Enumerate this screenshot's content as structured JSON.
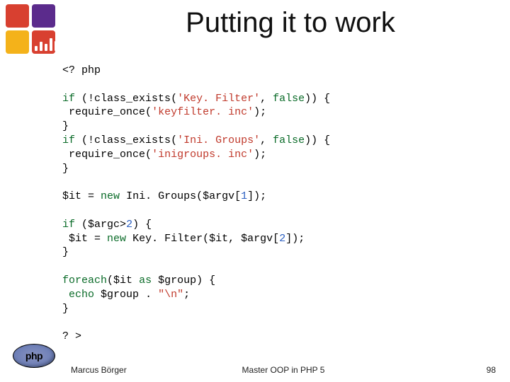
{
  "title": "Putting it to work",
  "code": {
    "open_tag": "<? php",
    "kw_if": "if",
    "kw_false": "false",
    "kw_new": "new",
    "kw_foreach": "foreach",
    "kw_as": "as",
    "kw_echo": "echo",
    "fn_class_exists": "class_exists",
    "fn_require_once": "require_once",
    "str_keyfilter": "'Key. Filter'",
    "str_keyfilter_inc": "'keyfilter. inc'",
    "str_inigroups": "'Ini. Groups'",
    "str_inigroups_inc": "'inigroups. inc'",
    "cls_inigroups": "Ini. Groups",
    "cls_keyfilter": "Key. Filter",
    "var_it": "$it",
    "var_argc": "$argc",
    "var_argv": "$argv",
    "var_group": "$group",
    "num_1": "1",
    "num_2": "2",
    "num_2b": "2",
    "str_nl": "\"\\n\"",
    "close_tag": "? >"
  },
  "footer": {
    "author": "Marcus Börger",
    "course": "Master OOP in PHP 5",
    "page": "98"
  },
  "php_logo_text": "php"
}
